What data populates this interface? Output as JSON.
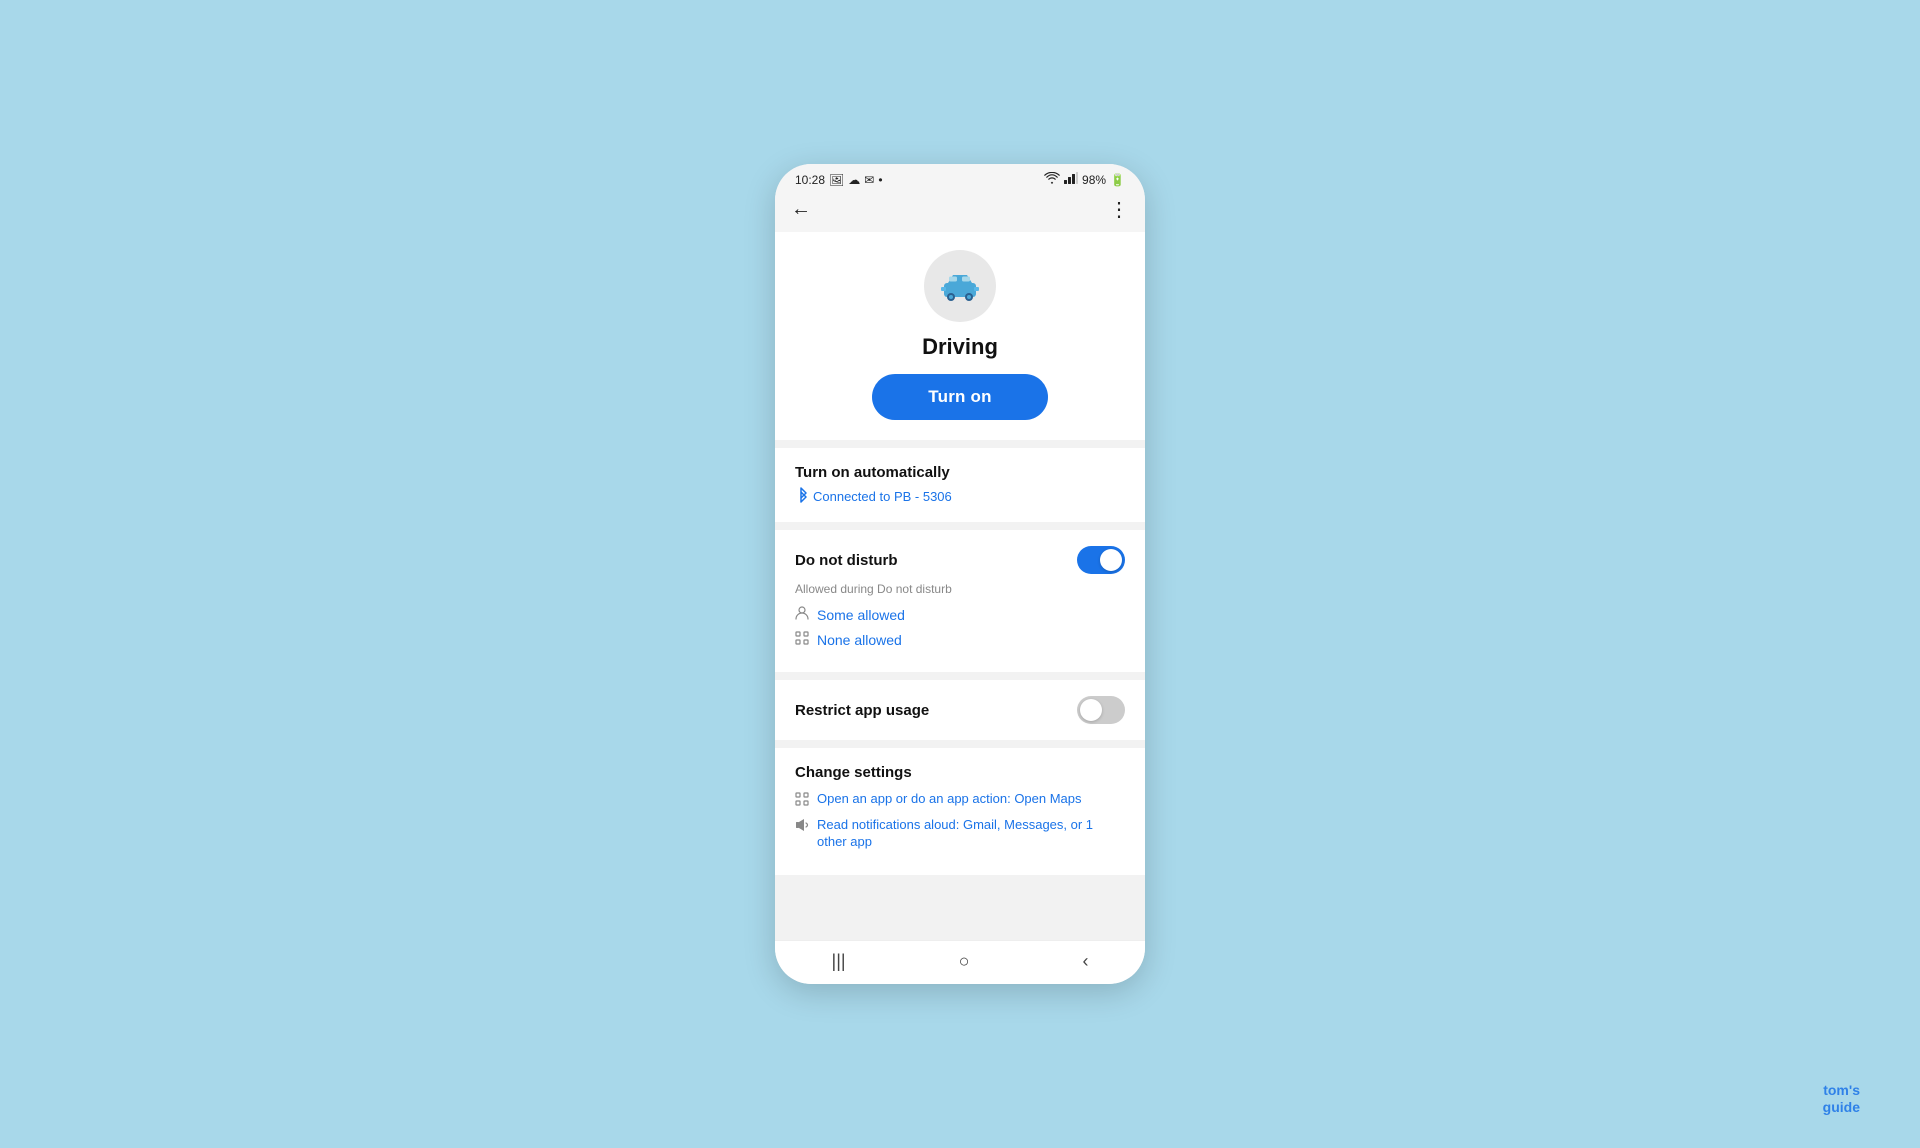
{
  "statusBar": {
    "time": "10:28",
    "battery": "98%",
    "icons": [
      "photo-icon",
      "cloud-icon",
      "mail-icon",
      "dot-icon",
      "wifi-icon",
      "signal-icon",
      "battery-icon"
    ]
  },
  "header": {
    "back_label": "←",
    "menu_label": "⋮"
  },
  "hero": {
    "icon_label": "car",
    "title": "Driving",
    "turn_on_button": "Turn on"
  },
  "turn_on_automatically": {
    "title": "Turn on automatically",
    "bluetooth_text": "Connected to PB - 5306"
  },
  "do_not_disturb": {
    "title": "Do not disturb",
    "enabled": true,
    "subtitle": "Allowed during Do not disturb",
    "items": [
      {
        "icon": "person",
        "text": "Some allowed"
      },
      {
        "icon": "apps",
        "text": "None allowed"
      }
    ]
  },
  "restrict_app_usage": {
    "title": "Restrict app usage",
    "enabled": false
  },
  "change_settings": {
    "title": "Change settings",
    "items": [
      {
        "icon": "apps",
        "text": "Open an app or do an app action: Open Maps"
      },
      {
        "icon": "speaker",
        "text": "Read notifications aloud: Gmail, Messages, or 1 other app"
      }
    ]
  },
  "bottomNav": {
    "recents": "|||",
    "home": "○",
    "back": "‹"
  },
  "watermark": {
    "line1": "tom's",
    "line2": "guide"
  }
}
